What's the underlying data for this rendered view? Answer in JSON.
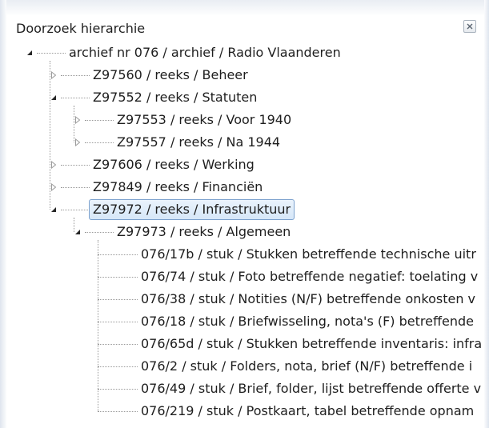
{
  "panel": {
    "title": "Doorzoek hierarchie",
    "close_icon": "close-icon"
  },
  "tree": [
    {
      "level": 0,
      "state": "expanded",
      "label": "archief nr 076 / archief / Radio Vlaanderen"
    },
    {
      "level": 1,
      "state": "collapsed",
      "label": "Z97560 / reeks / Beheer"
    },
    {
      "level": 1,
      "state": "expanded",
      "label": "Z97552 / reeks / Statuten"
    },
    {
      "level": 2,
      "state": "collapsed",
      "label": "Z97553 / reeks / Voor 1940"
    },
    {
      "level": 2,
      "state": "collapsed",
      "label": "Z97557 / reeks / Na 1944"
    },
    {
      "level": 1,
      "state": "collapsed",
      "label": "Z97606 / reeks / Werking"
    },
    {
      "level": 1,
      "state": "collapsed",
      "label": "Z97849 / reeks / Financiën"
    },
    {
      "level": 1,
      "state": "expanded",
      "selected": true,
      "label": "Z97972 / reeks / Infrastruktuur"
    },
    {
      "level": 2,
      "state": "expanded",
      "label": "Z97973 / reeks / Algemeen"
    },
    {
      "level": 3,
      "state": "leaf",
      "label": "076/17b / stuk / Stukken betreffende technische uitr"
    },
    {
      "level": 3,
      "state": "leaf",
      "label": "076/74 / stuk / Foto betreffende negatief: toelating v"
    },
    {
      "level": 3,
      "state": "leaf",
      "label": "076/38 / stuk / Notities (N/F) betreffende onkosten v"
    },
    {
      "level": 3,
      "state": "leaf",
      "label": "076/18 / stuk / Briefwisseling, nota's (F) betreffende"
    },
    {
      "level": 3,
      "state": "leaf",
      "label": "076/65d / stuk / Stukken betreffende inventaris: infra"
    },
    {
      "level": 3,
      "state": "leaf",
      "label": "076/2 / stuk / Folders, nota, brief (N/F) betreffende i"
    },
    {
      "level": 3,
      "state": "leaf",
      "label": "076/49 / stuk / Brief, folder, lijst betreffende offerte v"
    },
    {
      "level": 3,
      "state": "leaf",
      "label": "076/219 / stuk / Postkaart, tabel betreffende opnam"
    }
  ]
}
